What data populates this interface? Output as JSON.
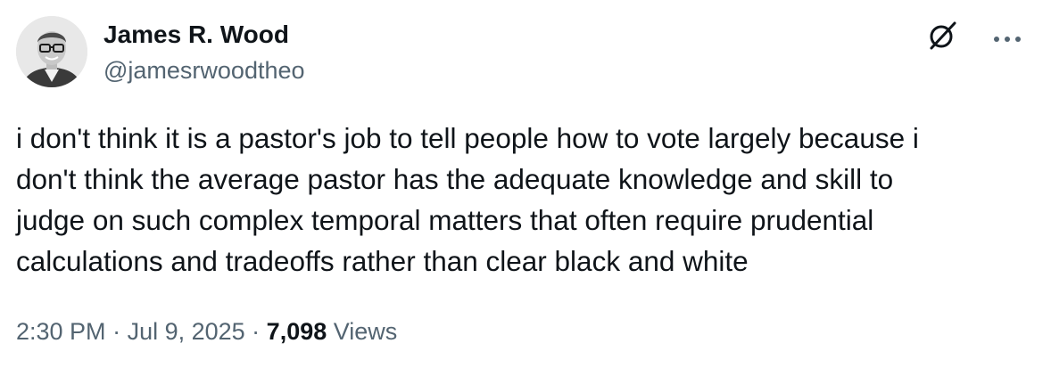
{
  "author": {
    "name": "James R. Wood",
    "handle": "@jamesrwoodtheo"
  },
  "icons": {
    "avatar": "profile-photo",
    "grok": "grok-icon",
    "more": "more-icon"
  },
  "tweet": {
    "lines": [
      "i don't think it is a pastor's job to tell people how to vote largely because i",
      "don't think the average pastor has the adequate knowledge and skill to",
      "judge on such complex temporal matters that often require prudential",
      "calculations and tradeoffs rather than clear black and white"
    ]
  },
  "meta": {
    "time": "2:30 PM",
    "separator1": " · ",
    "date": "Jul 9, 2025",
    "separator2": " · ",
    "views_count": "7,098",
    "views_label": " Views"
  },
  "colors": {
    "text_primary": "#0f1419",
    "text_secondary": "#536471",
    "background": "#ffffff"
  }
}
